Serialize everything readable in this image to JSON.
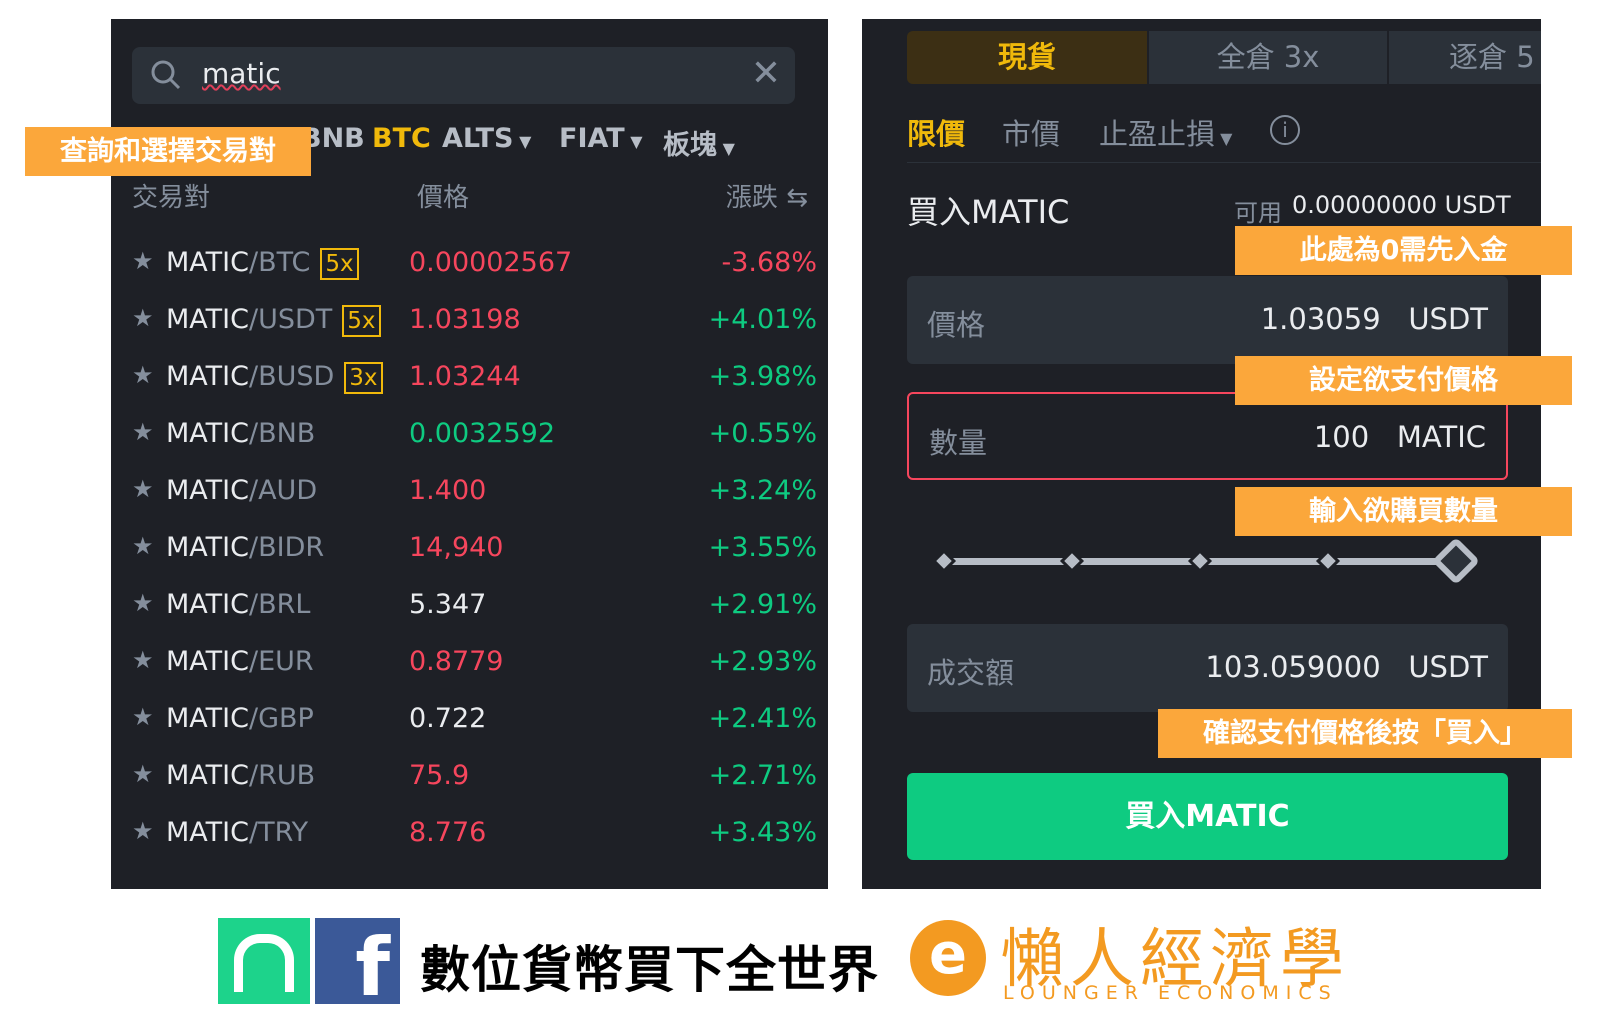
{
  "search": {
    "value": "matic"
  },
  "market_tabs": [
    {
      "label": "BNB"
    },
    {
      "label": "BTC",
      "active": true
    },
    {
      "label": "ALTS"
    },
    {
      "label": "FIAT"
    },
    {
      "label": "板塊"
    }
  ],
  "columns": {
    "pair": "交易對",
    "price": "價格",
    "change": "漲跌"
  },
  "rows": [
    {
      "base": "MATIC",
      "quote": "/BTC",
      "lev": "5x",
      "price": "0.00002567",
      "price_color": "red",
      "change": "-3.68%",
      "change_color": "red"
    },
    {
      "base": "MATIC",
      "quote": "/USDT",
      "lev": "5x",
      "price": "1.03198",
      "price_color": "red",
      "change": "+4.01%",
      "change_color": "green"
    },
    {
      "base": "MATIC",
      "quote": "/BUSD",
      "lev": "3x",
      "price": "1.03244",
      "price_color": "red",
      "change": "+3.98%",
      "change_color": "green"
    },
    {
      "base": "MATIC",
      "quote": "/BNB",
      "lev": "",
      "price": "0.0032592",
      "price_color": "green",
      "change": "+0.55%",
      "change_color": "green"
    },
    {
      "base": "MATIC",
      "quote": "/AUD",
      "lev": "",
      "price": "1.400",
      "price_color": "red",
      "change": "+3.24%",
      "change_color": "green"
    },
    {
      "base": "MATIC",
      "quote": "/BIDR",
      "lev": "",
      "price": "14,940",
      "price_color": "red",
      "change": "+3.55%",
      "change_color": "green"
    },
    {
      "base": "MATIC",
      "quote": "/BRL",
      "lev": "",
      "price": "5.347",
      "price_color": "white",
      "change": "+2.91%",
      "change_color": "green"
    },
    {
      "base": "MATIC",
      "quote": "/EUR",
      "lev": "",
      "price": "0.8779",
      "price_color": "red",
      "change": "+2.93%",
      "change_color": "green"
    },
    {
      "base": "MATIC",
      "quote": "/GBP",
      "lev": "",
      "price": "0.722",
      "price_color": "white",
      "change": "+2.41%",
      "change_color": "green"
    },
    {
      "base": "MATIC",
      "quote": "/RUB",
      "lev": "",
      "price": "75.9",
      "price_color": "red",
      "change": "+2.71%",
      "change_color": "green"
    },
    {
      "base": "MATIC",
      "quote": "/TRY",
      "lev": "",
      "price": "8.776",
      "price_color": "red",
      "change": "+3.43%",
      "change_color": "green"
    }
  ],
  "annotations": {
    "search": "查詢和選擇交易對",
    "deposit": "此處為0需先入金",
    "price": "設定欲支付價格",
    "amount": "輸入欲購買數量",
    "confirm": "確認支付價格後按「買入」"
  },
  "mode_tabs": [
    {
      "label": "現貨"
    },
    {
      "label": "全倉 3x"
    },
    {
      "label": "逐倉 5"
    }
  ],
  "order_types": {
    "limit": "限價",
    "market": "市價",
    "stop": "止盈止損"
  },
  "order": {
    "title": "買入MATIC",
    "avail_label": "可用",
    "avail_value": "0.00000000 USDT",
    "price_label": "價格",
    "price_value": "1.03059",
    "price_unit": "USDT",
    "amount_label": "數量",
    "amount_value": "100",
    "amount_unit": "MATIC",
    "slider_percent": 100,
    "total_label": "成交額",
    "total_value": "103.059000",
    "total_unit": "USDT",
    "buy_button": "買入MATIC"
  },
  "footer": {
    "slogan": "數位貨幣買下全世界",
    "brand_cn": "懶人經濟學",
    "brand_en": "LOUNGER ECONOMICS"
  },
  "colors": {
    "accent": "#f0b90b",
    "up": "#0ecb81",
    "down": "#f6465d",
    "note": "#fba73b",
    "fb": "#3b5998",
    "line": "#1dd38b",
    "brand": "#f39a21"
  }
}
